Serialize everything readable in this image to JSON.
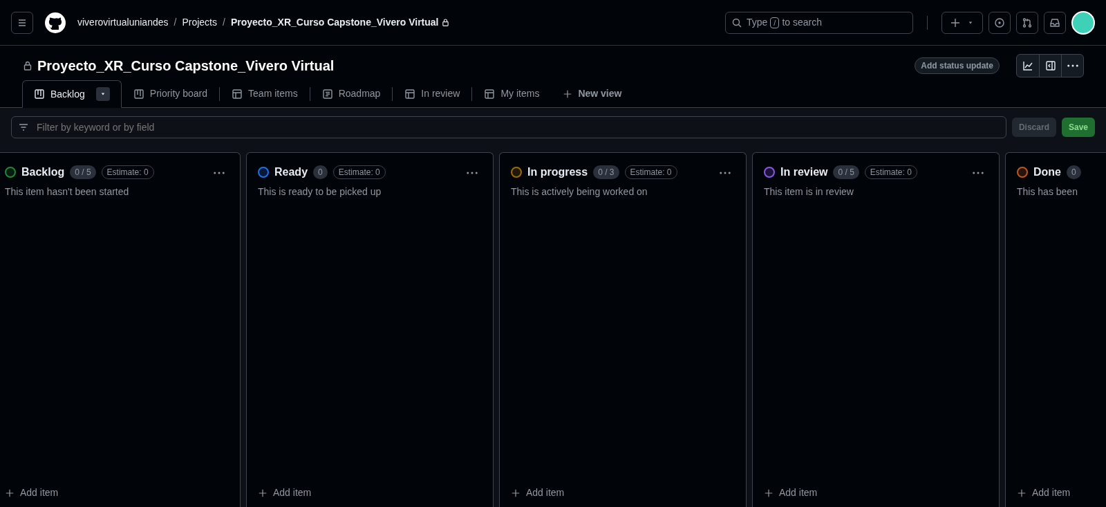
{
  "header": {
    "breadcrumbs": [
      {
        "label": "viverovirtualuniandes",
        "current": false
      },
      {
        "label": "Projects",
        "current": false,
        "separator": "/"
      },
      {
        "label": "Proyecto_XR_Curso Capstone_Vivero Virtual",
        "current": true,
        "separator": "/"
      }
    ],
    "search": {
      "before": "Type",
      "key": "/",
      "after": "to search"
    }
  },
  "project": {
    "title": "Proyecto_XR_Curso Capstone_Vivero Virtual",
    "status_button": "Add status update"
  },
  "views": [
    {
      "label": "Backlog",
      "kind": "board",
      "selected": true
    },
    {
      "label": "Priority board",
      "kind": "board",
      "selected": false
    },
    {
      "label": "Team items",
      "kind": "table",
      "selected": false
    },
    {
      "label": "Roadmap",
      "kind": "roadmap",
      "selected": false
    },
    {
      "label": "In review",
      "kind": "table",
      "selected": false
    },
    {
      "label": "My items",
      "kind": "table",
      "selected": false
    }
  ],
  "new_view": "New view",
  "filter": {
    "placeholder": "Filter by keyword or by field",
    "discard": "Discard",
    "save": "Save"
  },
  "columns": [
    {
      "name": "Backlog",
      "color": "#238636",
      "count": "0 / 5",
      "estimate": "Estimate: 0",
      "description": "This item hasn't been started",
      "add": "Add item",
      "clipped": false
    },
    {
      "name": "Ready",
      "color": "#1f6feb",
      "count": "0",
      "estimate": "Estimate: 0",
      "description": "This is ready to be picked up",
      "add": "Add item",
      "clipped": false
    },
    {
      "name": "In progress",
      "color": "#9e6a03",
      "count": "0 / 3",
      "estimate": "Estimate: 0",
      "description": "This is actively being worked on",
      "add": "Add item",
      "clipped": false
    },
    {
      "name": "In review",
      "color": "#8957e5",
      "count": "0 / 5",
      "estimate": "Estimate: 0",
      "description": "This item is in review",
      "add": "Add item",
      "clipped": false
    },
    {
      "name": "Done",
      "color": "#bd561d",
      "count": "0",
      "description": "This has been",
      "add": "Add item",
      "clipped": true
    }
  ]
}
